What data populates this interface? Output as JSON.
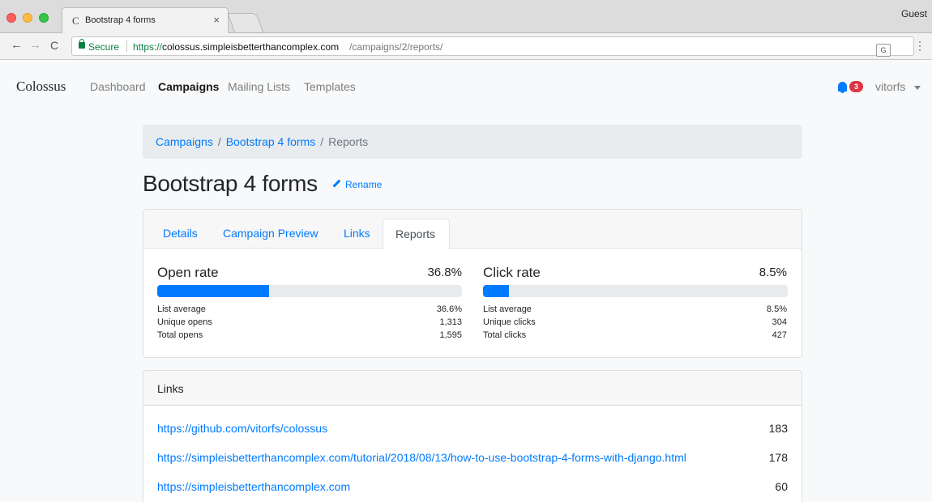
{
  "browser": {
    "tab_title": "Bootstrap 4 forms",
    "tab_favicon": "C",
    "tab_close": "×",
    "profile": "Guest",
    "secure_label": "Secure",
    "url_scheme": "https://",
    "url_host": "colossus.simpleisbetterthancomplex.com",
    "url_path": "/campaigns/2/reports/"
  },
  "navbar": {
    "brand": "Colossus",
    "links": [
      "Dashboard",
      "Campaigns",
      "Mailing Lists",
      "Templates"
    ],
    "active": "Campaigns",
    "notification_count": "3",
    "user": "vitorfs"
  },
  "breadcrumb": {
    "items": [
      "Campaigns",
      "Bootstrap 4 forms"
    ],
    "separator": "/",
    "current": "Reports"
  },
  "page": {
    "title": "Bootstrap 4 forms",
    "rename_label": "Rename"
  },
  "tabs": {
    "items": [
      "Details",
      "Campaign Preview",
      "Links"
    ],
    "active": "Reports"
  },
  "open_rate": {
    "title": "Open rate",
    "percent": "36.8%",
    "fill": 0.368,
    "stats": [
      {
        "label": "List average",
        "value": "36.6%"
      },
      {
        "label": "Unique opens",
        "value": "1,313"
      },
      {
        "label": "Total opens",
        "value": "1,595"
      }
    ]
  },
  "click_rate": {
    "title": "Click rate",
    "percent": "8.5%",
    "fill": 0.085,
    "stats": [
      {
        "label": "List average",
        "value": "8.5%"
      },
      {
        "label": "Unique clicks",
        "value": "304"
      },
      {
        "label": "Total clicks",
        "value": "427"
      }
    ]
  },
  "links": {
    "title": "Links",
    "rows": [
      {
        "url": "https://github.com/vitorfs/colossus",
        "count": "183"
      },
      {
        "url": "https://simpleisbetterthancomplex.com/tutorial/2018/08/13/how-to-use-bootstrap-4-forms-with-django.html",
        "count": "178"
      },
      {
        "url": "https://simpleisbetterthancomplex.com",
        "count": "60"
      }
    ]
  },
  "colors": {
    "primary": "#007bff",
    "secure": "#0b8043",
    "badge": "#dc3545"
  }
}
